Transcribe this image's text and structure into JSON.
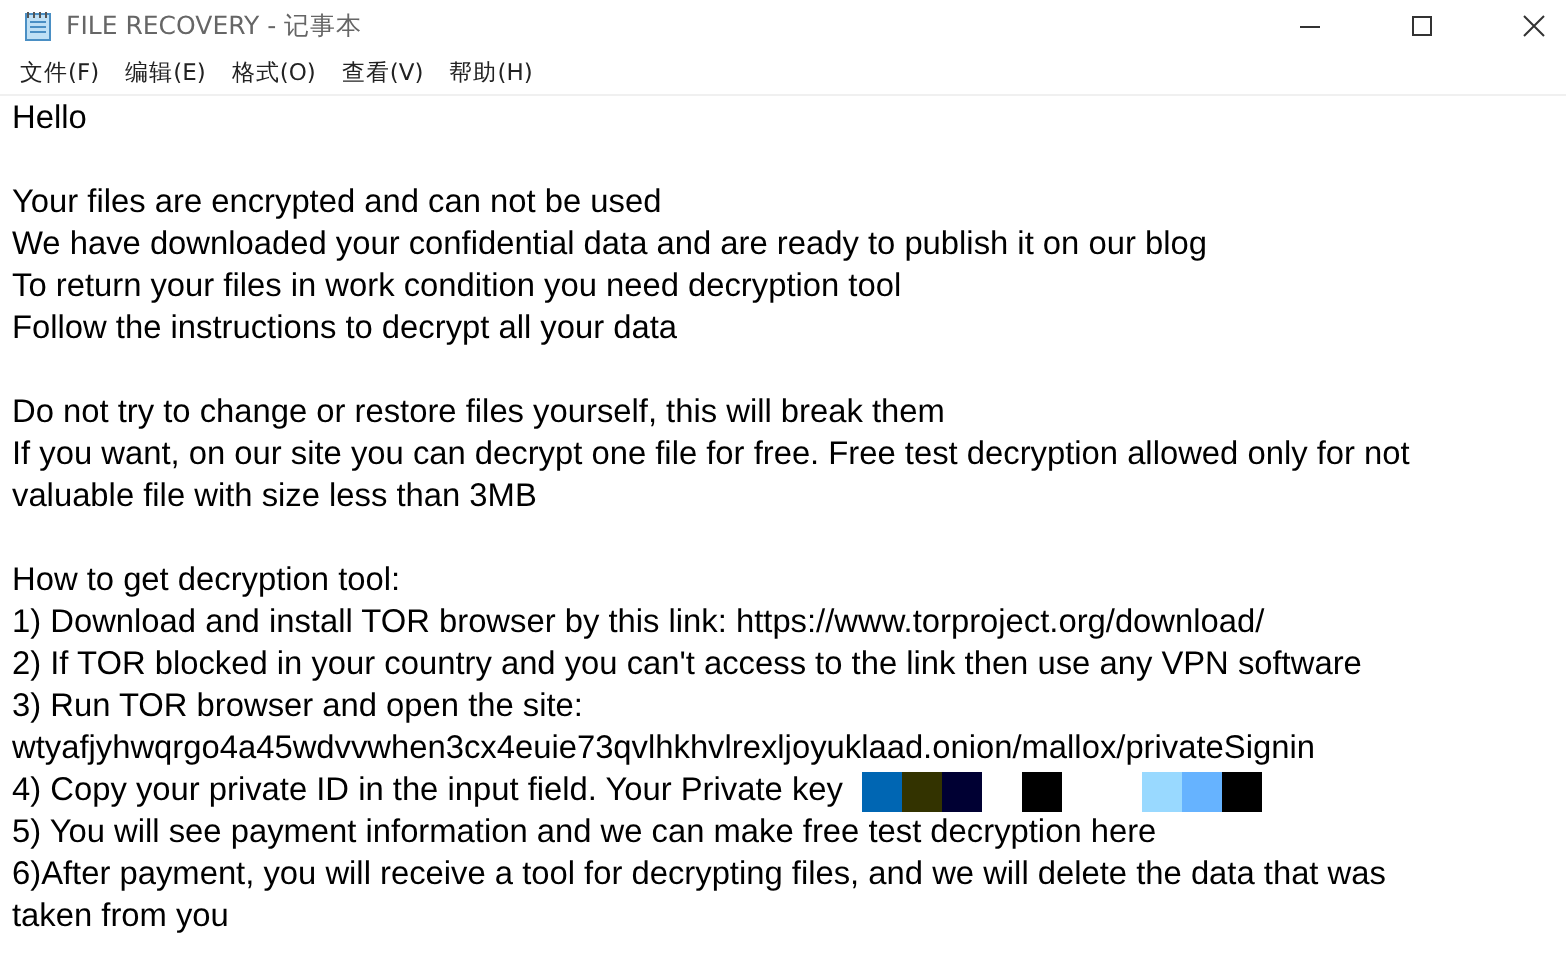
{
  "window": {
    "title": "FILE RECOVERY - 记事本"
  },
  "menu": [
    "文件(F)",
    "编辑(E)",
    "格式(O)",
    "查看(V)",
    "帮助(H)"
  ],
  "paragraphs": [
    [
      {
        "text": "Hello"
      }
    ],
    [
      {
        "text": "Your files are encrypted and can not be used"
      },
      {
        "text": "We have downloaded your confidential data and are ready to publish it on our blog"
      },
      {
        "text": "To return your files in work condition you need decryption tool"
      },
      {
        "text": "Follow the instructions to decrypt all your data"
      }
    ],
    [
      {
        "text": "Do not try to change or restore files yourself, this will break them"
      },
      {
        "text": "If you want, on our site you can decrypt one file for free. Free test decryption allowed only for not"
      },
      {
        "text": "valuable file with size less than 3MB"
      }
    ],
    [
      {
        "text": "How to get decryption tool:"
      },
      {
        "text": "1) Download and install TOR browser by this link: https://www.torproject.org/download/"
      },
      {
        "text": "2) If TOR blocked in your country and you can't access to the link then use any VPN software"
      },
      {
        "text": "3) Run TOR browser and open the site:"
      },
      {
        "text": "wtyafjyhwqrgo4a45wdvvwhen3cx4euie73qvlhkhvlrexljoyuklaad.onion/mallox/privateSignin"
      },
      {
        "text": "4) Copy your private ID in the input field. Your Private key",
        "redaction": [
          {
            "kind": "block",
            "color": "#0066b3"
          },
          {
            "kind": "block",
            "color": "#333300"
          },
          {
            "kind": "block",
            "color": "#000033"
          },
          {
            "kind": "gap"
          },
          {
            "kind": "block",
            "color": "#000000"
          },
          {
            "kind": "gap"
          },
          {
            "kind": "gap"
          },
          {
            "kind": "block",
            "color": "#99d9ff"
          },
          {
            "kind": "block",
            "color": "#66b3ff"
          },
          {
            "kind": "block",
            "color": "#000000"
          }
        ]
      },
      {
        "text": "5) You will see payment information and we can make free test decryption here"
      },
      {
        "text": "6)After payment, you will receive a tool for decrypting files, and we will delete the data that was"
      },
      {
        "text": "taken from you"
      }
    ]
  ]
}
